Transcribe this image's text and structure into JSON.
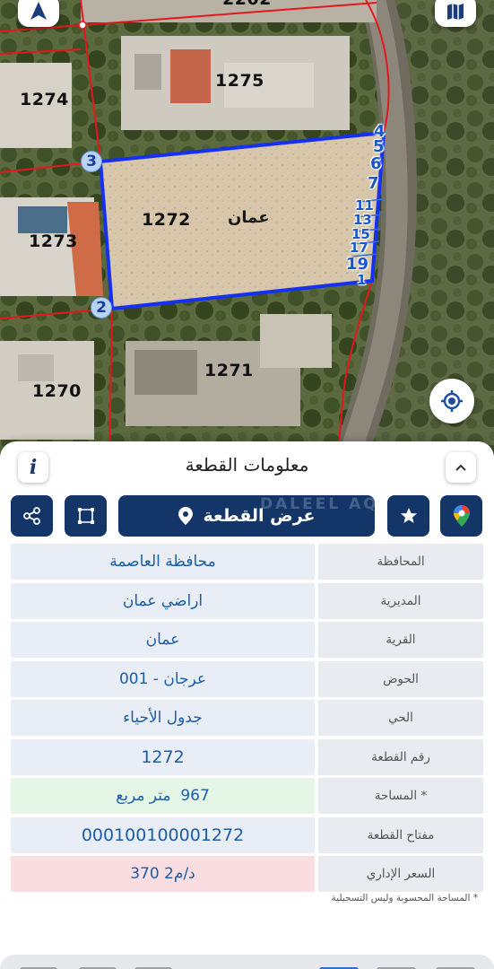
{
  "map": {
    "top_partial_label": "2202",
    "parcels": [
      {
        "id": "p1274",
        "label": "1274"
      },
      {
        "id": "p1275",
        "label": "1275"
      },
      {
        "id": "p1273",
        "label": "1273"
      },
      {
        "id": "p1272",
        "label": "1272"
      },
      {
        "id": "p1271",
        "label": "1271"
      },
      {
        "id": "p1270",
        "label": "1270"
      }
    ],
    "city_label": "عمان",
    "vertices": [
      "1",
      "2",
      "3",
      "4",
      "5",
      "6",
      "7",
      "11",
      "13",
      "15",
      "17",
      "19"
    ],
    "colors": {
      "selected_border": "#1530f0",
      "parcel_lines": "#e8161c",
      "vertex_text": "#1a56c8"
    },
    "icons": {
      "compass": "north-arrow-icon",
      "layers": "map-layers-icon",
      "locate": "my-location-icon"
    }
  },
  "sheet": {
    "title": "معلومات القطعة",
    "info_icon_label": "i",
    "actions": {
      "view_parcel": "عرض القطعة",
      "watermark": "DALEEL AQAR"
    },
    "rows": [
      {
        "label": "المحافظة",
        "value": "محافظة العاصمة"
      },
      {
        "label": "المديرية",
        "value": "اراضي عمان"
      },
      {
        "label": "القرية",
        "value": "عمان"
      },
      {
        "label": "الحوض",
        "value": "عرجان - 001"
      },
      {
        "label": "الحي",
        "value": "جدول الأحياء"
      },
      {
        "label": "رقم القطعة",
        "value": "1272"
      },
      {
        "label": "المساحة *",
        "value_num": "967",
        "value_unit": "متر مربع"
      },
      {
        "label": "مفتاح القطعة",
        "value": "000100100001272"
      },
      {
        "label": "السعر الإداري",
        "value": "370 د/م2"
      }
    ],
    "footnote": "* المساحة المحسوبة وليس التسجيلية",
    "colors": {
      "primary": "#133567",
      "label_bg": "#e9ebf1",
      "value_bg": "#e8edf6",
      "area_bg": "#e6f6e6",
      "price_bg": "#f9dde0",
      "value_text": "#1a5da8"
    }
  }
}
